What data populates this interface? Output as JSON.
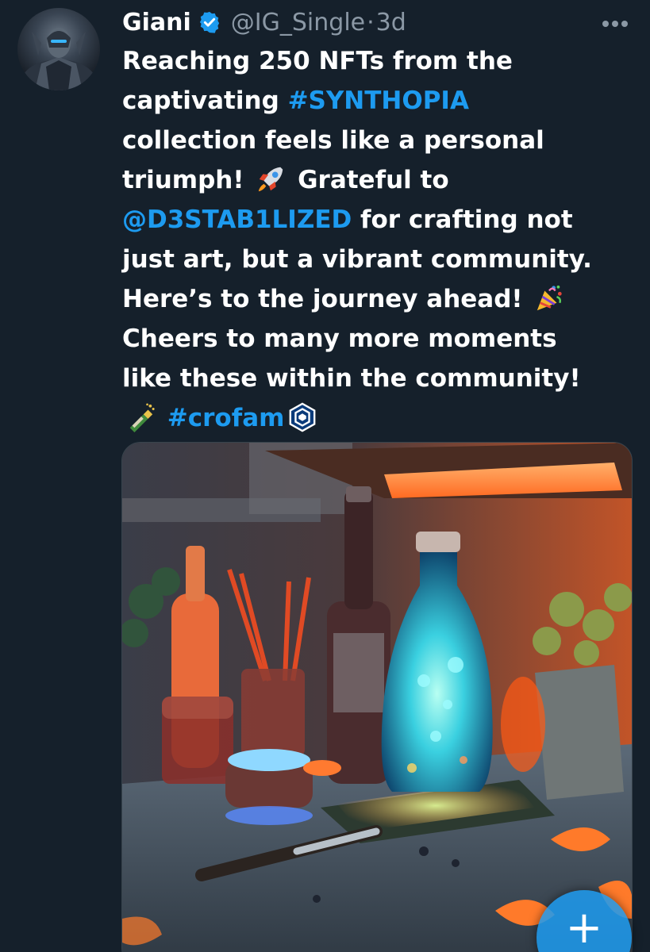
{
  "tweet": {
    "author": {
      "display_name": "Giani",
      "handle": "@IG_Single",
      "verified_icon": "verified-badge-icon"
    },
    "separator": "·",
    "timestamp": "3d",
    "text_lines": [
      {
        "parts": [
          {
            "text": "Reaching 250 NFTs from the"
          }
        ]
      },
      {
        "parts": [
          {
            "text": "captivating "
          },
          {
            "text": "#SYNTHOPIA",
            "link": true
          }
        ]
      },
      {
        "parts": [
          {
            "text": "collection feels like a personal"
          }
        ]
      },
      {
        "parts": [
          {
            "text": "triumph! "
          },
          {
            "emoji": "rocket-icon"
          },
          {
            "text": " Grateful to"
          }
        ]
      },
      {
        "parts": [
          {
            "text": "@D3STAB1LIZED",
            "link": true
          },
          {
            "text": " for crafting not"
          }
        ]
      },
      {
        "parts": [
          {
            "text": "just art, but a vibrant community."
          }
        ]
      },
      {
        "parts": [
          {
            "text": "Here’s to the journey ahead! "
          },
          {
            "emoji": "party-popper-icon"
          }
        ]
      },
      {
        "parts": [
          {
            "text": "Cheers to many more moments"
          }
        ]
      },
      {
        "parts": [
          {
            "text": "like these within the community!"
          }
        ]
      },
      {
        "parts": [
          {
            "emoji": "champagne-bottle-icon"
          },
          {
            "text": " "
          },
          {
            "text": "#crofam",
            "link": true
          },
          {
            "emoji": "cronos-logo-icon"
          }
        ]
      }
    ],
    "media": {
      "kind": "image",
      "subject": "glowing bottle still life"
    }
  },
  "compose_button": {
    "icon": "plus-icon",
    "label": "+"
  },
  "more_icon": "more-options-icon",
  "colors": {
    "background": "#15202b",
    "text": "#ffffff",
    "secondary_text": "#8b98a5",
    "link": "#1d9bf0",
    "accent": "#1d9bf0"
  }
}
